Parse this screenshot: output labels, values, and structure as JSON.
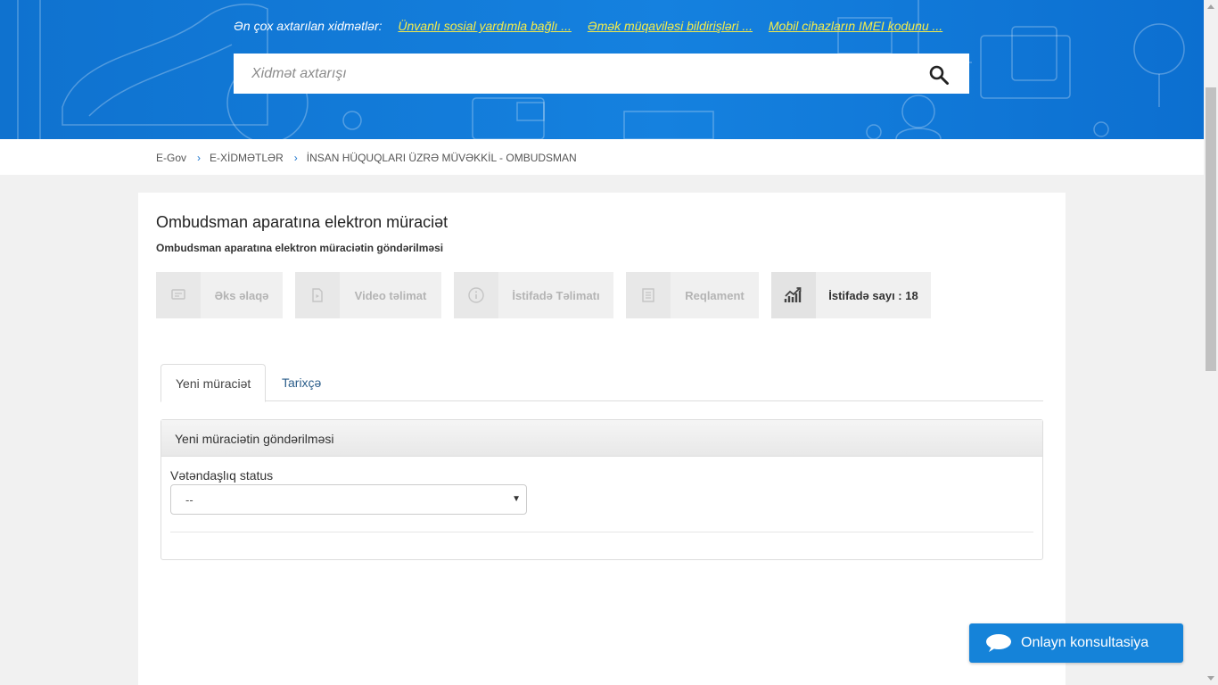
{
  "header": {
    "popular_label": "Ən çox axtarılan xidmətlər:",
    "popular_links": [
      "Ünvanlı sosial yardımla bağlı ...",
      "Əmək müqaviləsi bildirişləri ...",
      "Mobil cihazların IMEI kodunu ..."
    ],
    "search_placeholder": "Xidmət axtarışı",
    "search_icon": "search-icon",
    "accent_color": "#1581df",
    "link_color": "#f5ec4a"
  },
  "breadcrumb": [
    "E-Gov",
    "E-XİDMƏTLƏR",
    "İNSAN HÜQUQLARI ÜZRƏ MÜVƏKKİL - OMBUDSMAN"
  ],
  "service": {
    "title": "Ombudsman aparatına elektron müraciət",
    "subtitle": "Ombudsman aparatına elektron müraciətin göndərilməsi"
  },
  "actions": [
    {
      "label": "Əks əlaqə",
      "icon": "feedback-icon",
      "enabled": false
    },
    {
      "label": "Video təlimat",
      "icon": "video-icon",
      "enabled": false
    },
    {
      "label": "İstifadə Təlimatı",
      "icon": "info-icon",
      "enabled": false
    },
    {
      "label": "Reqlament",
      "icon": "document-icon",
      "enabled": false
    },
    {
      "label": "İstifadə sayı : 18",
      "icon": "chart-icon",
      "enabled": true
    }
  ],
  "tabs": [
    "Yeni müraciət",
    "Tarixçə"
  ],
  "form": {
    "panel_title": "Yeni müraciətin göndərilməsi",
    "citizenship_label": "Vətəndaşlıq status",
    "citizenship_value": "--"
  },
  "chat": {
    "label": "Onlayn konsultasiya",
    "icon": "chat-bubble-icon",
    "color": "#1583d9"
  }
}
